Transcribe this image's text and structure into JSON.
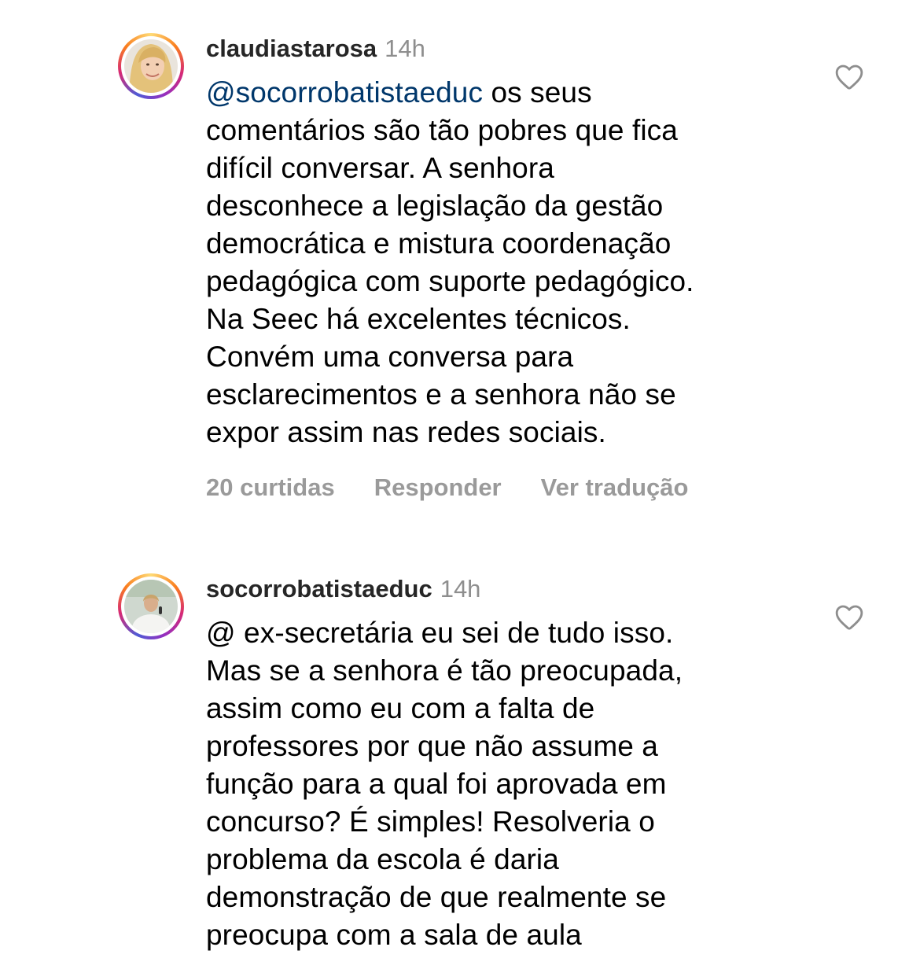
{
  "comments": [
    {
      "username": "claudiastarosa",
      "time": "14h",
      "mention": "@socorrobatistaeduc",
      "text": " os seus\ncomentários são tão pobres que fica\ndifícil conversar. A senhora\ndesconhece a legislação da gestão\ndemocrática e mistura coordenação\npedagógica com suporte pedagógico.\nNa Seec há excelentes técnicos.\nConvém uma conversa para\nesclarecimentos e a senhora não se\nexpor assim nas redes sociais.",
      "likes_label": "20 curtidas",
      "reply_label": "Responder",
      "translate_label": "Ver tradução",
      "avatar": "woman-blonde-hair-avatar",
      "like_icon": "heart-outline-icon"
    },
    {
      "username": "socorrobatistaeduc",
      "time": "14h",
      "text": "@ ex-secretária eu sei de tudo isso.\nMas se a senhora é  tão  preocupada,\nassim como eu com a falta de\nprofessores por  que não  assume a\nfunção para a qual foi aprovada em\nconcurso? É  simples! Resolveria o\nproblema da escola é daria\ndemonstração de que realmente se\npreocupa com a sala de aula",
      "avatar": "woman-speaking-microphone-avatar",
      "like_icon": "heart-outline-icon"
    }
  ],
  "colors": {
    "username": "#262626",
    "meta": "#8e8e8e",
    "mention": "#00376b",
    "actions": "#9a9a9a"
  }
}
